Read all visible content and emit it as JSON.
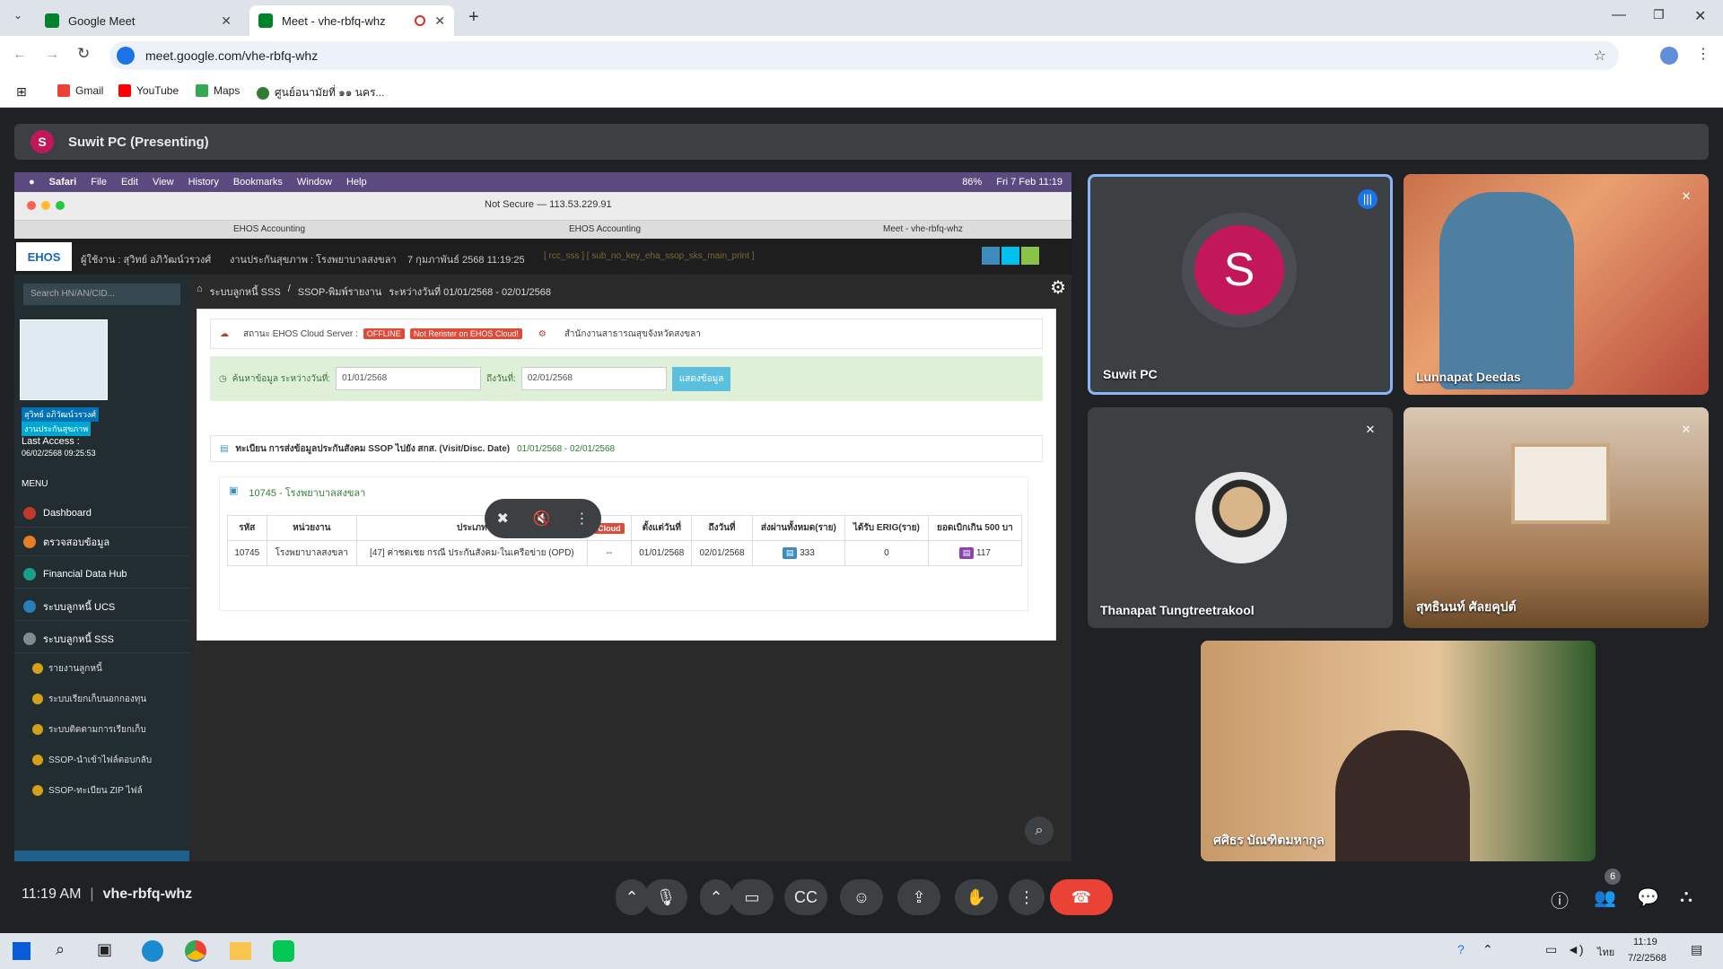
{
  "browser": {
    "tabs": [
      {
        "label": "Google Meet",
        "active": false
      },
      {
        "label": "Meet - vhe-rbfq-whz",
        "active": true
      }
    ],
    "url": "meet.google.com/vhe-rbfq-whz",
    "bookmarks": [
      "Gmail",
      "YouTube",
      "Maps",
      "ศูนย์อนามัยที่ ๑๑ นคร..."
    ]
  },
  "meet": {
    "presenter_initial": "S",
    "presenting_label": "Suwit PC (Presenting)",
    "time": "11:19 AM",
    "meeting_code": "vhe-rbfq-whz",
    "participants_count": "6",
    "participants": [
      {
        "name": "Suwit PC",
        "initial": "S"
      },
      {
        "name": "Lunnapat Deedas"
      },
      {
        "name": "Thanapat Tungtreetrakool"
      },
      {
        "name": "สุทธินนท์ ศัลยคุปต์"
      },
      {
        "name": "ศศิธร บัณฑิตมหากุล"
      }
    ]
  },
  "shared": {
    "mac_menu": [
      "Safari",
      "File",
      "Edit",
      "View",
      "History",
      "Bookmarks",
      "Window",
      "Help"
    ],
    "mac_status": "Fri 7 Feb 11:19",
    "mac_battery": "86%",
    "address": "Not Secure — 113.53.229.91",
    "safari_tabs": [
      "EHOS Accounting",
      "EHOS Accounting",
      "Meet - vhe-rbfq-whz"
    ],
    "ehos": {
      "logo": "EHOS",
      "user_line": "ผู้ใช้งาน : สุวิทย์ อภิวัฒน์วรวงศ์",
      "unit_line": "งานประกันสุขภาพ : โรงพยาบาลสงขลา",
      "date_line": "7 กุมภาพันธ์ 2568 11:19:25",
      "tag_line": "[ rcc_sss ] [ sub_no_key_eha_ssop_sks_main_print ]",
      "search_placeholder": "Search HN/AN/CID...",
      "user_name_badge": "สุวิทย์ อภิวัฒน์วรวงศ์",
      "user_dept_badge": "งานประกันสุขภาพ",
      "last_access_label": "Last Access :",
      "last_access": "06/02/2568 09:25:53",
      "menu_label": "MENU",
      "menu": [
        "Dashboard",
        "ตรวจสอบข้อมูล",
        "Financial Data Hub",
        "ระบบลูกหนี้ UCS",
        "ระบบลูกหนี้ SSS"
      ],
      "submenu": [
        "รายงานลูกหนี้",
        "ระบบเรียกเก็บนอกกองทุน",
        "ระบบติดตามการเรียกเก็บ",
        "SSOP-นำเข้าไฟล์ตอบกลับ",
        "SSOP-ทะเบียน ZIP ไฟล์"
      ],
      "breadcrumb": [
        "ระบบลูกหนี้ SSS",
        "SSOP-พิมพ์รายงาน",
        "ระหว่างวันที่ 01/01/2568 - 02/01/2568"
      ],
      "status_label": "สถานะ EHOS Cloud Server :",
      "status_offline": "OFFLINE",
      "status_not_register": "Not Rerister on EHOS Cloud!",
      "office_label": "สำนักงานสาธารณสุขจังหวัดสงขลา",
      "search_label": "ค้นหาข้อมูล ระหว่างวันที่:",
      "date_from": "01/01/2568",
      "to_label": "ถึงวันที่:",
      "date_to": "02/01/2568",
      "show_button": "แสดงข้อมูล",
      "register_title": "ทะเบียน การส่งข้อมูลประกันสังคม SSOP ไปยัง สกส. (Visit/Disc. Date)",
      "register_range": "01/01/2568 - 02/01/2568",
      "hospital_label": "10745 - โรงพยาบาลสงขลา",
      "table": {
        "headers": [
          "รหัส",
          "หน่วยงาน",
          "ประเภท",
          "Cloud",
          "ตั้งแต่วันที่",
          "ถึงวันที่",
          "ส่งผ่านทั้งหมด(ราย)",
          "ได้รับ ERIG(ราย)",
          "ยอดเบิกเกิน 500 บา"
        ],
        "rows": [
          [
            "10745",
            "โรงพยาบาลสงขลา",
            "[47] ค่าชดเชย กรณี ประกันสังคม-ในเครือข่าย (OPD)",
            "--",
            "01/01/2568",
            "02/01/2568",
            "333",
            "0",
            "117"
          ]
        ]
      }
    }
  },
  "taskbar": {
    "time": "11:19",
    "date": "7/2/2568",
    "lang": "ไทย"
  }
}
